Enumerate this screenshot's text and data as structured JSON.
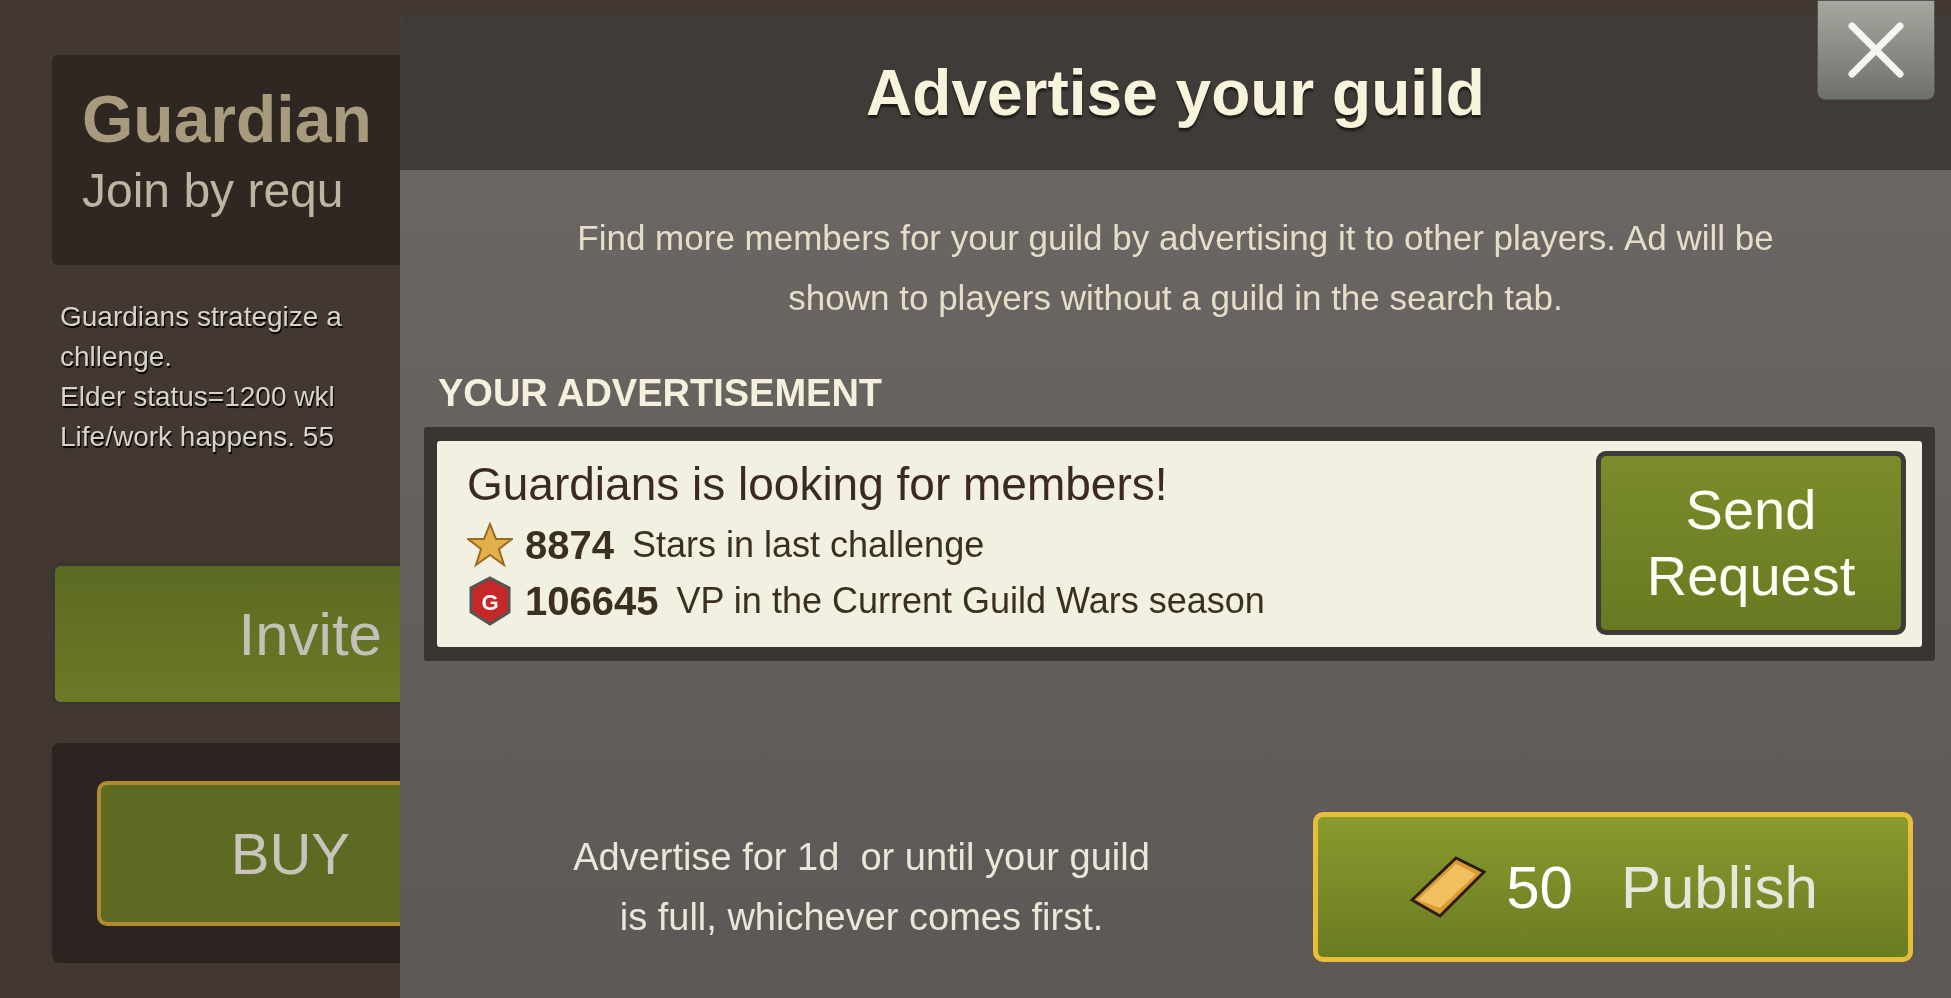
{
  "background": {
    "guild_name": "Guardian",
    "join_mode": "Join by requ",
    "description_lines": [
      "Guardians strategize a",
      "chllenge.",
      "Elder status=1200 wkl",
      "Life/work happens. 55"
    ],
    "invite_button": "Invite",
    "buy_button": "BUY"
  },
  "dialog": {
    "title": "Advertise your guild",
    "intro": "Find more members for your guild by advertising it to other players. Ad will be shown to players without a guild in the search tab.",
    "section_heading": "YOUR ADVERTISEMENT",
    "ad": {
      "headline": "Guardians is looking for members!",
      "stats": [
        {
          "kind": "stars",
          "value": "8874",
          "label": "Stars in last challenge"
        },
        {
          "kind": "vp",
          "icon_letter": "G",
          "value": "106645",
          "label": "VP in the Current Guild Wars season"
        }
      ],
      "button": "Send Request"
    },
    "duration_note": "Advertise for 1d  or until your guild is full, whichever comes first.",
    "publish": {
      "cost": "50",
      "label": "Publish"
    }
  }
}
